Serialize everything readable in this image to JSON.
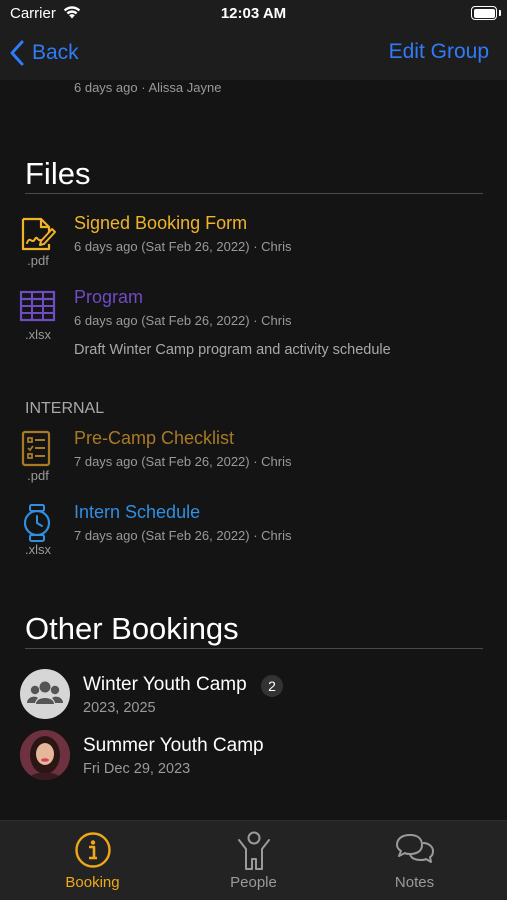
{
  "status_bar": {
    "carrier": "Carrier",
    "time": "12:03 AM"
  },
  "nav": {
    "back_label": "Back",
    "edit_label": "Edit Group"
  },
  "previous_item_meta": "6 days ago · Alissa Jayne",
  "files_section": {
    "title": "Files",
    "files": [
      {
        "name": "Signed Booking Form",
        "ext": ".pdf",
        "meta": "6 days ago (Sat Feb 26, 2022) · Chris",
        "color": "#f0b429",
        "icon": "signed-document-icon"
      },
      {
        "name": "Program",
        "ext": ".xlsx",
        "meta": "6 days ago (Sat Feb 26, 2022) · Chris",
        "description": "Draft Winter Camp program and activity schedule",
        "color": "#6f4bc4",
        "icon": "spreadsheet-grid-icon"
      }
    ],
    "internal_label": "INTERNAL",
    "internal_files": [
      {
        "name": "Pre-Camp Checklist",
        "ext": ".pdf",
        "meta": "7 days ago (Sat Feb 26, 2022) · Chris",
        "color": "#a87a25",
        "icon": "checklist-icon"
      },
      {
        "name": "Intern Schedule",
        "ext": ".xlsx",
        "meta": "7 days ago (Sat Feb 26, 2022) · Chris",
        "color": "#2f8fe0",
        "icon": "watch-icon"
      }
    ]
  },
  "other_bookings": {
    "title": "Other Bookings",
    "items": [
      {
        "title": "Winter Youth Camp",
        "badge": "2",
        "subtitle": "2023, 2025",
        "avatar": "group-icon"
      },
      {
        "title": "Summer Youth Camp",
        "subtitle": "Fri Dec 29, 2023",
        "avatar": "person-photo"
      }
    ]
  },
  "tabs": [
    {
      "label": "Booking",
      "icon": "info-circle-icon",
      "active": true
    },
    {
      "label": "People",
      "icon": "person-icon",
      "active": false
    },
    {
      "label": "Notes",
      "icon": "speech-bubbles-icon",
      "active": false
    }
  ],
  "colors": {
    "accent": "#f0a818",
    "link": "#2f7cf6",
    "inactive_tab": "#9a9a9a",
    "background": "#141414"
  }
}
